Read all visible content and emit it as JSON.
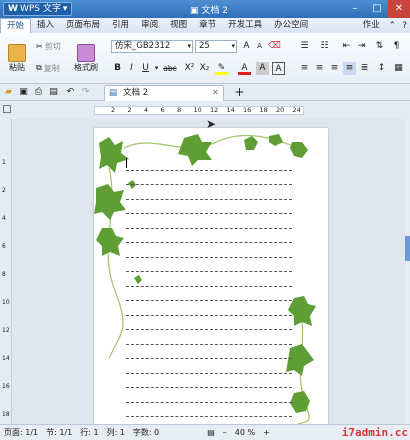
{
  "titlebar": {
    "logo_text": "WPS 文字",
    "doc_title": "文档 2"
  },
  "menu": {
    "tabs": [
      "开始",
      "插入",
      "页面布局",
      "引用",
      "审阅",
      "视图",
      "章节",
      "开发工具",
      "办公空间"
    ],
    "right_label": "作业"
  },
  "ribbon": {
    "paste_label": "粘贴",
    "cut_label": "剪切",
    "copy_label": "复制",
    "format_painter_label": "格式刷",
    "font_name": "仿宋_GB2312",
    "font_size": "25",
    "bold": "B",
    "italic": "I",
    "underline": "U",
    "abc": "abc"
  },
  "doc_tab": {
    "label": "文档 2"
  },
  "ruler": {
    "labels": [
      "2",
      "2",
      "4",
      "6",
      "8",
      "10",
      "12",
      "14",
      "16",
      "18",
      "20",
      "24"
    ]
  },
  "vruler": {
    "labels": [
      "1",
      "2",
      "4",
      "6",
      "8",
      "10",
      "12",
      "14",
      "16",
      "18"
    ]
  },
  "status": {
    "page": "页面: 1/1",
    "section": "节: 1/1",
    "row": "行: 1",
    "col": "列: 1",
    "words": "字数: 0",
    "zoom": "40 %"
  },
  "watermark": "i7admin.cc"
}
